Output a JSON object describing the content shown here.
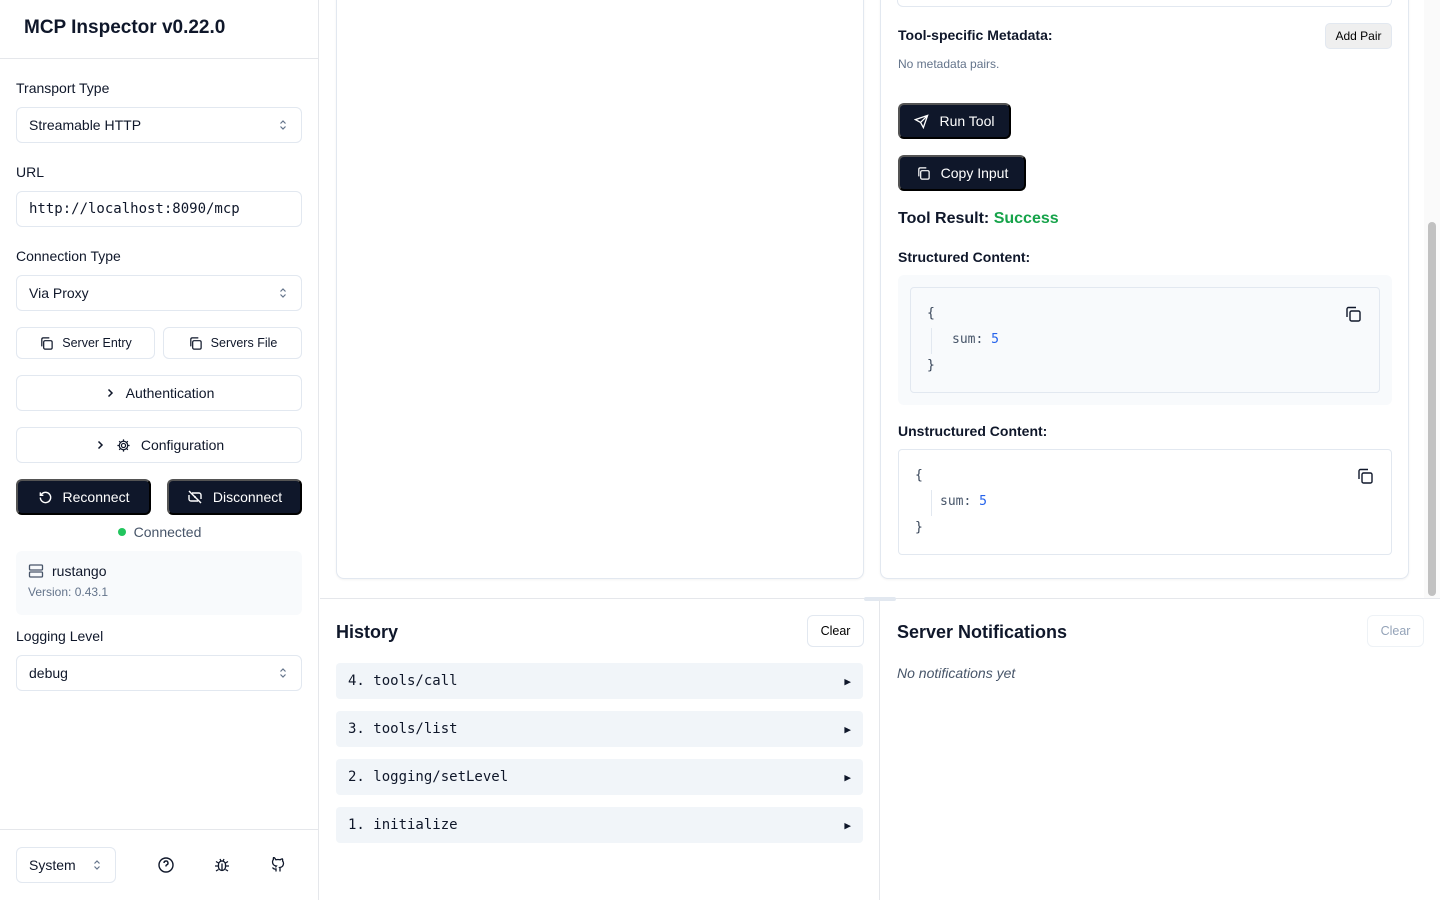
{
  "app": {
    "title": "MCP Inspector v0.22.0"
  },
  "sidebar": {
    "transport_label": "Transport Type",
    "transport_value": "Streamable HTTP",
    "url_label": "URL",
    "url_value": "http://localhost:8090/mcp",
    "connection_label": "Connection Type",
    "connection_value": "Via Proxy",
    "server_entry_label": "Server Entry",
    "servers_file_label": "Servers File",
    "authentication_label": "Authentication",
    "configuration_label": "Configuration",
    "reconnect_label": "Reconnect",
    "disconnect_label": "Disconnect",
    "status_text": "Connected",
    "server_name": "rustango",
    "server_version": "Version: 0.43.1",
    "logging_label": "Logging Level",
    "logging_value": "debug",
    "theme_value": "System"
  },
  "tool_panel": {
    "metadata_label": "Tool-specific Metadata:",
    "add_pair_label": "Add Pair",
    "no_metadata": "No metadata pairs.",
    "run_tool_label": "Run Tool",
    "copy_input_label": "Copy Input",
    "result_label": "Tool Result:",
    "result_status": "Success",
    "structured_label": "Structured Content:",
    "unstructured_label": "Unstructured Content:",
    "json_open": "{",
    "json_close": "}",
    "json_key": "sum:",
    "json_value": "5"
  },
  "history": {
    "title": "History",
    "clear_label": "Clear",
    "items": [
      {
        "label": "4. tools/call"
      },
      {
        "label": "3. tools/list"
      },
      {
        "label": "2. logging/setLevel"
      },
      {
        "label": "1. initialize"
      }
    ],
    "expand_glyph": "▶"
  },
  "notifications": {
    "title": "Server Notifications",
    "clear_label": "Clear",
    "empty_text": "No notifications yet"
  },
  "colors": {
    "primary": "#0f172a",
    "success": "#16a34a",
    "status_dot": "#22c55e",
    "json_number": "#2563eb"
  }
}
